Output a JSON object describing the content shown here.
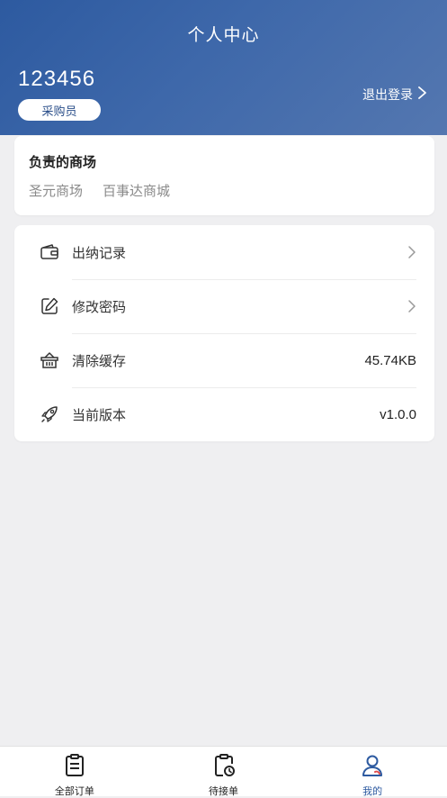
{
  "header": {
    "title": "个人中心",
    "user_id": "123456",
    "role": "采购员",
    "logout_label": "退出登录"
  },
  "malls": {
    "title": "负责的商场",
    "items": [
      "圣元商场",
      "百事达商城"
    ]
  },
  "menu": {
    "items": [
      {
        "label": "出纳记录",
        "icon": "wallet-icon",
        "value": ""
      },
      {
        "label": "修改密码",
        "icon": "edit-icon",
        "value": ""
      },
      {
        "label": "清除缓存",
        "icon": "basket-icon",
        "value": "45.74KB"
      },
      {
        "label": "当前版本",
        "icon": "rocket-icon",
        "value": "v1.0.0"
      }
    ]
  },
  "tabbar": {
    "items": [
      {
        "label": "全部订单",
        "icon": "clipboard-list-icon"
      },
      {
        "label": "待接单",
        "icon": "clipboard-clock-icon"
      },
      {
        "label": "我的",
        "icon": "user-icon"
      }
    ],
    "active_index": 2
  },
  "colors": {
    "header_start": "#2d5aa0",
    "header_end": "#5477b0",
    "background": "#efeff1",
    "accent": "#2d5aa0",
    "accent_red": "#e04b4b"
  }
}
